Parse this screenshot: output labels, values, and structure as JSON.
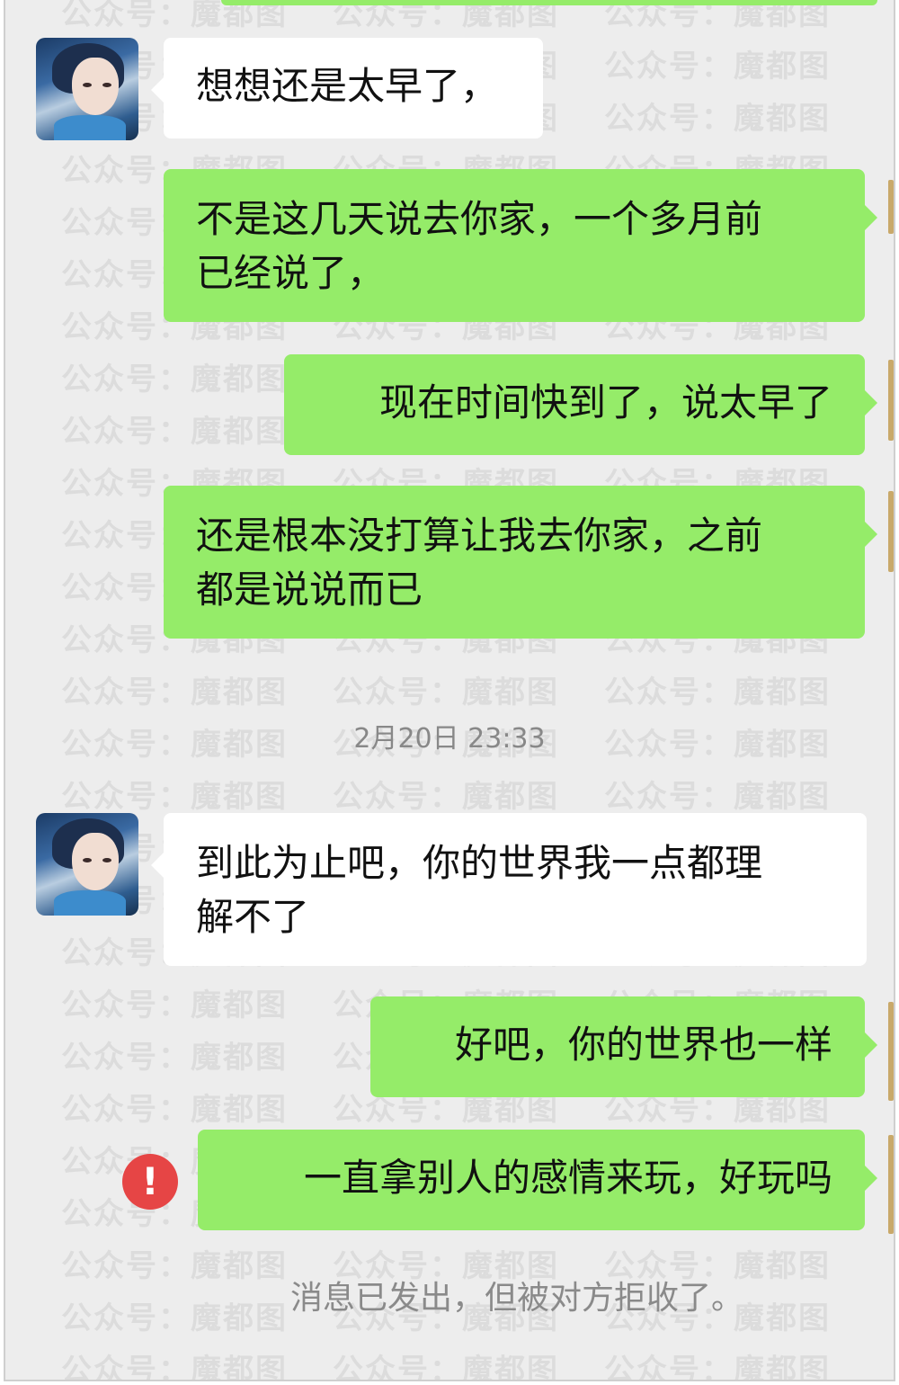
{
  "messages": [
    {
      "side": "left",
      "text": "想想还是太早了，"
    },
    {
      "side": "right",
      "lines": [
        "不是这几天说去你家，一个多月前",
        "已经说了，"
      ]
    },
    {
      "side": "right",
      "text": "现在时间快到了，说太早了"
    },
    {
      "side": "right",
      "lines": [
        "还是根本没打算让我去你家，之前",
        "都是说说而已"
      ]
    },
    {
      "side": "left",
      "lines": [
        "到此为止吧，你的世界我一点都理",
        "解不了"
      ]
    },
    {
      "side": "right",
      "text": "好吧，你的世界也一样"
    },
    {
      "side": "right",
      "text": "一直拿别人的感情来玩，好玩吗",
      "failed": true
    }
  ],
  "timestamp": "2月20日 23:33",
  "error_icon": "!",
  "rejected_notice": "消息已发出，但被对方拒收了。",
  "watermark": {
    "a": "公众号：",
    "b": "魔都图"
  },
  "colors": {
    "background": "#ededed",
    "sent_bubble": "#95ec69",
    "received_bubble": "#ffffff",
    "error": "#e64545"
  },
  "icons": {
    "avatar": "contact-avatar",
    "error": "exclamation-circle-icon"
  }
}
